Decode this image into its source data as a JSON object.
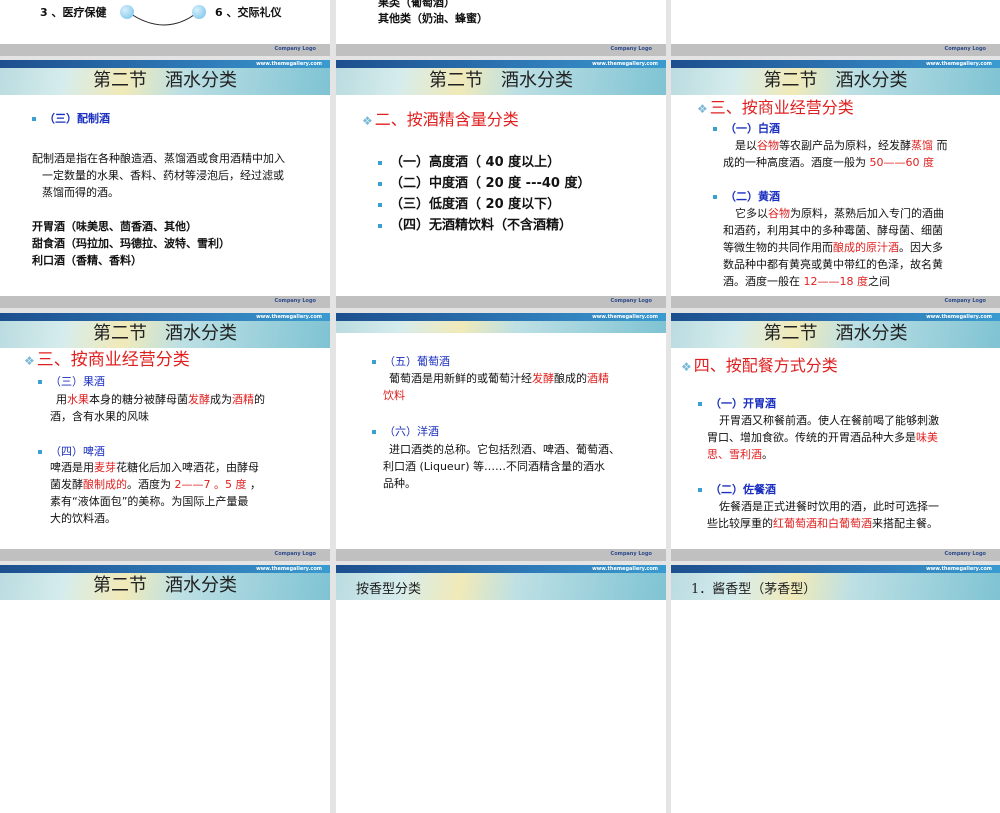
{
  "header": {
    "title": "第二节　酒水分类",
    "url": "www.themegallery.com",
    "company_logo": "Company Logo"
  },
  "slides": {
    "s1": {
      "item3": "3 、医疗保健",
      "item6": "6 、交际礼仪"
    },
    "s2": {
      "line1": "果类（葡萄酒）",
      "line2": "其他类（奶油、蜂蜜）"
    },
    "s4": {
      "heading": "（三）配制酒",
      "para": [
        "配制酒是指在各种酿造酒、蒸馏酒或食用酒精中加入",
        "一定数量的水果、香料、药材等浸泡后，经过滤或",
        "蒸馏而得的酒。"
      ],
      "items": [
        "开胃酒（味美思、茴香酒、其他）",
        "甜食酒（玛拉加、玛德拉、波特、雪利）",
        "利口酒（香精、香料）"
      ]
    },
    "s5": {
      "heading": "二、按酒精含量分类",
      "items": [
        "（一）高度酒（ 40 度以上）",
        "（二）中度酒（ 20 度 ---40 度）",
        "（三）低度酒（ 20 度以下）",
        "（四）无酒精饮料（不含酒精）"
      ]
    },
    "s6": {
      "heading": "三、按商业经营分类",
      "sub1": "（一）白酒",
      "p1": [
        "是以",
        "谷物",
        "等农副产品为原料，经发酵",
        "蒸馏",
        " 而",
        "成的一种高度酒。酒度一般为 ",
        "50——60 度"
      ],
      "sub2": "（二）黄酒",
      "p2": [
        "它多以",
        "谷物",
        "为原料，蒸熟后加入专门的酒曲",
        "和酒药，利用其中的多种霉菌、酵母菌、细菌",
        "等微生物的共同作用而",
        "酿成的原汁酒",
        "。因大多",
        "数品种中都有黄亮或黄中带红的色泽，故名黄",
        "酒。酒度一般在 ",
        "12——18 度",
        "之间"
      ]
    },
    "s7": {
      "heading": "三、按商业经营分类",
      "sub1": "（三）果酒",
      "p1": [
        "用",
        "水果",
        "本身的糖分被酵母菌",
        "发酵",
        "成为",
        "酒精",
        "的",
        "酒，含有水果的风味"
      ],
      "sub2": "（四）啤酒",
      "p2": [
        "啤酒是用",
        "麦芽",
        "花糖化后加入啤酒花，由酵母",
        "菌发酵",
        "酿制成的",
        "。酒度为 ",
        "2——7 。5 度",
        " ，",
        "素有“液体面包”的美称。为国际上产量最",
        "大的饮料酒。"
      ]
    },
    "s8": {
      "sub1": "（五）葡萄酒",
      "p1": [
        "葡萄酒是用新鲜的或葡萄汁经",
        "发酵",
        "酿成的",
        "酒精",
        "饮料"
      ],
      "sub2": "（六）洋酒",
      "p2": [
        "进口酒类的总称。它包括烈酒、啤酒、葡萄酒、",
        "利口酒 (Liqueur) 等……不同酒精含量的酒水",
        "品种。"
      ]
    },
    "s9": {
      "heading": "四、按配餐方式分类",
      "sub1": "（一）开胃酒",
      "p1": [
        "开胃酒又称餐前酒。使人在餐前喝了能够刺激",
        "胃口、增加食欲。传统的开胃酒品种大多是",
        "味美",
        "思、雪利酒",
        "。"
      ],
      "sub2": "（二）佐餐酒",
      "p2": [
        "佐餐酒是正式进餐时饮用的酒，此时可选择一",
        "些比较厚重的",
        "红葡萄酒和白葡萄酒",
        "来搭配主餐。"
      ]
    },
    "s11": {
      "title": "按香型分类"
    },
    "s12": {
      "title": "1．酱香型（茅香型）"
    }
  }
}
